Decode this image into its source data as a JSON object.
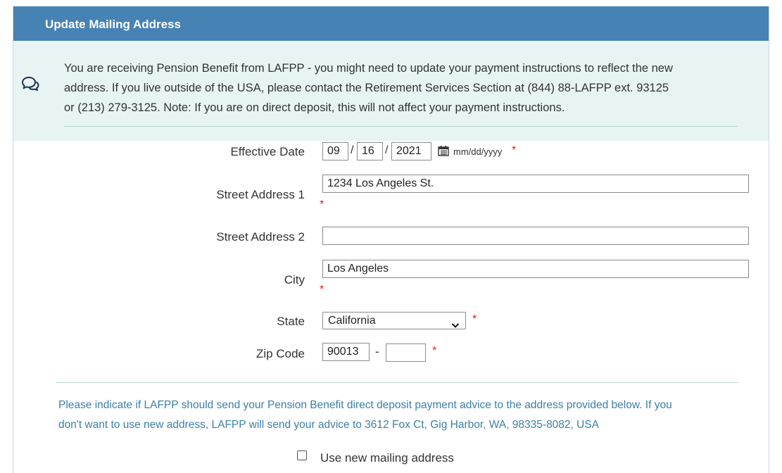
{
  "panel": {
    "title": "Update Mailing Address"
  },
  "notice": {
    "icon": "comments-icon",
    "line1": "You are receiving Pension Benefit from LAFPP - you might need to update your payment instructions to reflect the new",
    "line2": "address. If you live outside of the USA, please contact the Retirement Services Section at (844) 88-LAFPP ext. 93125",
    "line3": "or (213) 279-3125. Note: If you are on direct deposit, this will not affect your payment instructions."
  },
  "form": {
    "effective_date": {
      "label": "Effective Date",
      "month": "09",
      "day": "16",
      "year": "2021",
      "separator": "/",
      "format_hint": "mm/dd/yyyy",
      "icon": "calendar-icon"
    },
    "street1": {
      "label": "Street Address 1",
      "value": "1234 Los Angeles St."
    },
    "street2": {
      "label": "Street Address 2",
      "value": ""
    },
    "city": {
      "label": "City",
      "value": "Los Angeles"
    },
    "state": {
      "label": "State",
      "selected": "California"
    },
    "zip": {
      "label": "Zip Code",
      "value": "90013",
      "separator": "-",
      "ext": ""
    },
    "required_marker": "*"
  },
  "advice": {
    "line1": "Please indicate if LAFPP should send your Pension Benefit direct deposit payment advice to the address provided below. If you",
    "line2": "don't want to use new address, LAFPP will send your advice to 3612 Fox Ct, Gig Harbor, WA, 98335-8082, USA"
  },
  "use_new_address": {
    "label": "Use new mailing address",
    "checked": false
  },
  "colors": {
    "header": "#4682b4",
    "notice_bg": "#e8f3f3",
    "required": "#e02020",
    "advice_text": "#3c7fa6"
  }
}
